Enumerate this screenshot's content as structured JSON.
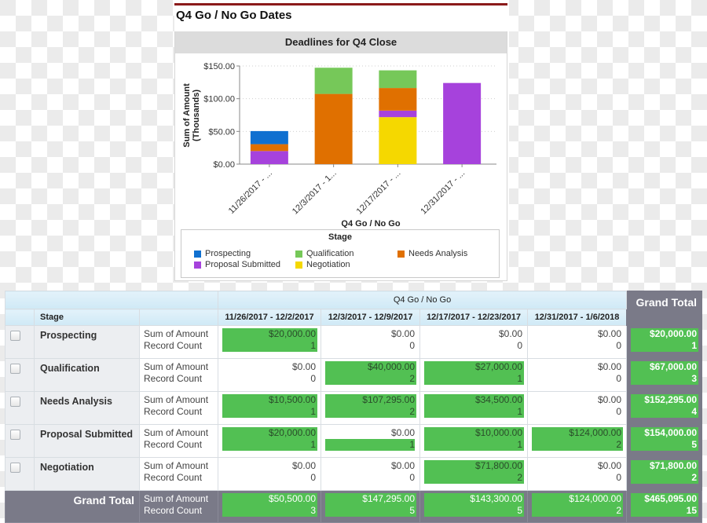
{
  "panel": {
    "title": "Q4 Go / No Go Dates",
    "chart_header": "Deadlines for Q4 Close"
  },
  "colors": {
    "Prospecting": "#1070d0",
    "Qualification": "#76c859",
    "Needs Analysis": "#e07000",
    "Proposal Submitted": "#a642dc",
    "Negotiation": "#f5d800",
    "accent_rule": "#8b1a1a",
    "highlight": "#52c053"
  },
  "chart_data": {
    "type": "bar",
    "stacked": true,
    "title": "Deadlines for Q4 Close",
    "xlabel": "Q4 Go / No Go",
    "ylabel": "Sum of Amount (Thousands)",
    "ylabel_lines": [
      "Sum of Amount",
      "(Thousands)"
    ],
    "ylim": [
      0,
      150
    ],
    "yticks": [
      0,
      50,
      100,
      150
    ],
    "ytick_labels": [
      "$0.00",
      "$50.00",
      "$100.00",
      "$150.00"
    ],
    "grid": true,
    "categories": [
      "11/26/2017 - ...",
      "12/3/2017 - 1...",
      "12/17/2017 - ...",
      "12/31/2017 - ..."
    ],
    "series": [
      {
        "name": "Prospecting",
        "values": [
          20,
          0,
          0,
          0
        ]
      },
      {
        "name": "Qualification",
        "values": [
          0,
          40,
          27,
          0
        ]
      },
      {
        "name": "Needs Analysis",
        "values": [
          10.5,
          107.295,
          34.5,
          0
        ]
      },
      {
        "name": "Proposal Submitted",
        "values": [
          20,
          0,
          10,
          124
        ]
      },
      {
        "name": "Negotiation",
        "values": [
          0,
          0,
          71.8,
          0
        ]
      }
    ],
    "stack_order": [
      "Negotiation",
      "Proposal Submitted",
      "Needs Analysis",
      "Qualification",
      "Prospecting"
    ],
    "legend": {
      "title": "Stage",
      "position": "bottom",
      "items": [
        "Prospecting",
        "Qualification",
        "Needs Analysis",
        "Proposal Submitted",
        "Negotiation"
      ]
    }
  },
  "table": {
    "group_header": "Q4 Go / No Go",
    "grand_total_header": "Grand Total",
    "stage_header": "Stage",
    "columns": [
      "11/26/2017 - 12/2/2017",
      "12/3/2017 - 12/9/2017",
      "12/17/2017 - 12/23/2017",
      "12/31/2017 - 1/6/2018"
    ],
    "measures": [
      "Sum of Amount",
      "Record Count"
    ],
    "rows": [
      {
        "stage": "Prospecting",
        "cells": [
          {
            "amount": "$20,000.00",
            "count": "1",
            "hl": "full"
          },
          {
            "amount": "$0.00",
            "count": "0",
            "hl": "none"
          },
          {
            "amount": "$0.00",
            "count": "0",
            "hl": "none"
          },
          {
            "amount": "$0.00",
            "count": "0",
            "hl": "none"
          }
        ],
        "total": {
          "amount": "$20,000.00",
          "count": "1"
        }
      },
      {
        "stage": "Qualification",
        "cells": [
          {
            "amount": "$0.00",
            "count": "0",
            "hl": "none"
          },
          {
            "amount": "$40,000.00",
            "count": "2",
            "hl": "full"
          },
          {
            "amount": "$27,000.00",
            "count": "1",
            "hl": "full"
          },
          {
            "amount": "$0.00",
            "count": "0",
            "hl": "none"
          }
        ],
        "total": {
          "amount": "$67,000.00",
          "count": "3"
        }
      },
      {
        "stage": "Needs Analysis",
        "cells": [
          {
            "amount": "$10,500.00",
            "count": "1",
            "hl": "full"
          },
          {
            "amount": "$107,295.00",
            "count": "2",
            "hl": "full"
          },
          {
            "amount": "$34,500.00",
            "count": "1",
            "hl": "full"
          },
          {
            "amount": "$0.00",
            "count": "0",
            "hl": "none"
          }
        ],
        "total": {
          "amount": "$152,295.00",
          "count": "4"
        }
      },
      {
        "stage": "Proposal Submitted",
        "cells": [
          {
            "amount": "$20,000.00",
            "count": "1",
            "hl": "full"
          },
          {
            "amount": "$0.00",
            "count": "1",
            "hl": "count"
          },
          {
            "amount": "$10,000.00",
            "count": "1",
            "hl": "full"
          },
          {
            "amount": "$124,000.00",
            "count": "2",
            "hl": "full"
          }
        ],
        "total": {
          "amount": "$154,000.00",
          "count": "5"
        }
      },
      {
        "stage": "Negotiation",
        "cells": [
          {
            "amount": "$0.00",
            "count": "0",
            "hl": "none"
          },
          {
            "amount": "$0.00",
            "count": "0",
            "hl": "none"
          },
          {
            "amount": "$71,800.00",
            "count": "2",
            "hl": "full"
          },
          {
            "amount": "$0.00",
            "count": "0",
            "hl": "none"
          }
        ],
        "total": {
          "amount": "$71,800.00",
          "count": "2"
        }
      }
    ],
    "grand_total_row": {
      "label": "Grand Total",
      "cells": [
        {
          "amount": "$50,500.00",
          "count": "3"
        },
        {
          "amount": "$147,295.00",
          "count": "5"
        },
        {
          "amount": "$143,300.00",
          "count": "5"
        },
        {
          "amount": "$124,000.00",
          "count": "2"
        }
      ],
      "total": {
        "amount": "$465,095.00",
        "count": "15"
      }
    }
  }
}
